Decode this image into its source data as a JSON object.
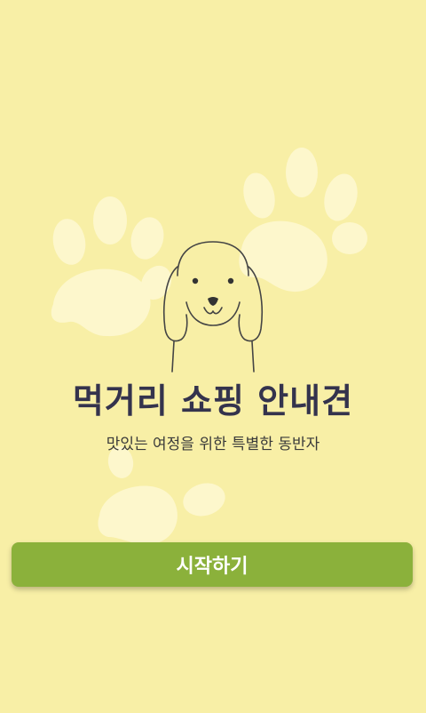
{
  "app": {
    "title": "먹거리 쇼핑 안내견",
    "subtitle": "맛있는 여정을 위한 특별한 동반자"
  },
  "actions": {
    "start_label": "시작하기"
  },
  "colors": {
    "background": "#f8efa6",
    "paw": "#fdf7cc",
    "button": "#8bb13b",
    "title": "#34334d"
  },
  "icons": {
    "background": "paw-print-icon",
    "mascot": "dog-face-icon"
  }
}
